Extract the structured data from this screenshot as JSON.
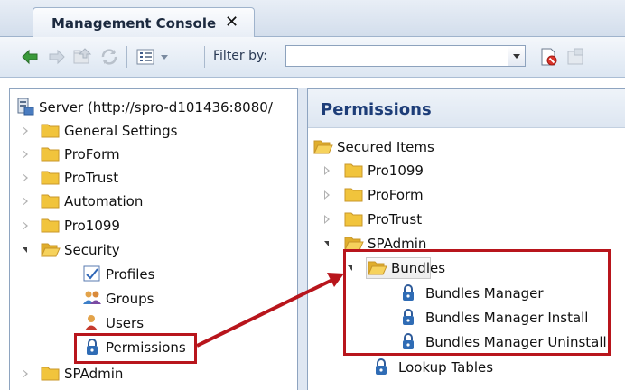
{
  "tab": {
    "title": "Management Console",
    "close_glyph": "✕"
  },
  "toolbar": {
    "filter_label": "Filter by:",
    "filter_value": "",
    "icons": [
      "back-arrow-icon",
      "forward-arrow-icon",
      "up-folder-icon",
      "refresh-icon",
      "view-options-icon",
      "dropdown-icon",
      "delete-document-icon",
      "properties-icon"
    ]
  },
  "left_tree": {
    "server": "Server (http://spro-d101436:8080/",
    "items": [
      {
        "label": "General Settings",
        "expanded": false
      },
      {
        "label": "ProForm",
        "expanded": false
      },
      {
        "label": "ProTrust",
        "expanded": false
      },
      {
        "label": "Automation",
        "expanded": false
      },
      {
        "label": "Pro1099",
        "expanded": false
      },
      {
        "label": "Security",
        "expanded": true
      }
    ],
    "security_children": [
      "Profiles",
      "Groups",
      "Users",
      "Permissions"
    ],
    "trailing": {
      "label": "SPAdmin",
      "expanded": false
    }
  },
  "right": {
    "title": "Permissions",
    "root": "Secured Items",
    "items": [
      {
        "label": "Pro1099",
        "expanded": false
      },
      {
        "label": "ProForm",
        "expanded": false
      },
      {
        "label": "ProTrust",
        "expanded": false
      },
      {
        "label": "SPAdmin",
        "expanded": true
      }
    ],
    "bundles": {
      "label": "Bundles",
      "children": [
        "Bundles Manager",
        "Bundles Manager Install",
        "Bundles Manager Uninstall"
      ]
    },
    "lookup": "Lookup Tables"
  },
  "colors": {
    "highlight_red": "#b8151c",
    "title_blue": "#1d3d78",
    "folder": "#f1c43c"
  }
}
